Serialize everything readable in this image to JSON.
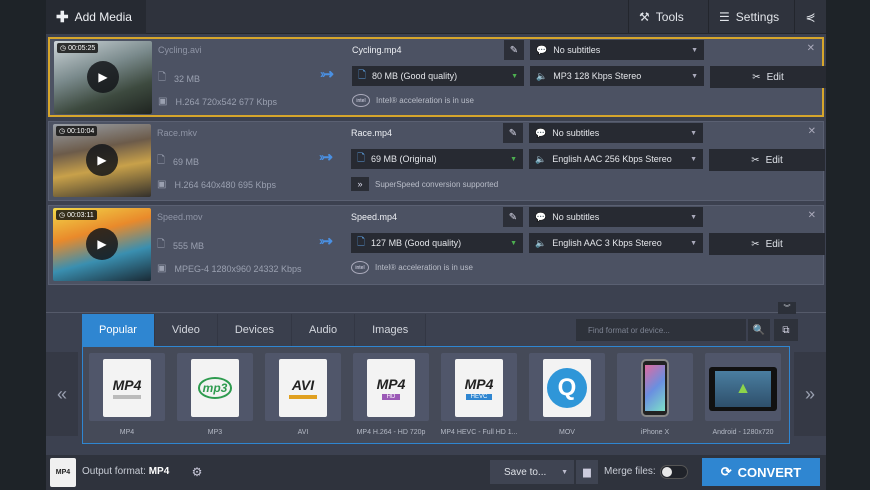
{
  "toolbar": {
    "add_media": "Add Media",
    "tools": "Tools",
    "settings": "Settings"
  },
  "files": [
    {
      "duration": "00:05:25",
      "source_name": "Cycling.avi",
      "source_size": "32 MB",
      "source_codec": "H.264 720x542 677 Kbps",
      "output_name": "Cycling.mp4",
      "output_size": "80 MB (Good quality)",
      "subtitles": "No subtitles",
      "audio": "MP3 128 Kbps Stereo",
      "accel": "Intel® acceleration is in use",
      "edit": "Edit",
      "selected": true
    },
    {
      "duration": "00:10:04",
      "source_name": "Race.mkv",
      "source_size": "69 MB",
      "source_codec": "H.264 640x480 695 Kbps",
      "output_name": "Race.mp4",
      "output_size": "69 MB (Original)",
      "subtitles": "No subtitles",
      "audio": "English AAC 256 Kbps Stereo",
      "accel": "SuperSpeed conversion supported",
      "edit": "Edit",
      "selected": false
    },
    {
      "duration": "00:03:11",
      "source_name": "Speed.mov",
      "source_size": "555 MB",
      "source_codec": "MPEG-4 1280x960 24332 Kbps",
      "output_name": "Speed.mp4",
      "output_size": "127 MB (Good quality)",
      "subtitles": "No subtitles",
      "audio": "English AAC 3 Kbps Stereo",
      "accel": "Intel® acceleration is in use",
      "edit": "Edit",
      "selected": false
    }
  ],
  "tabs": [
    "Popular",
    "Video",
    "Devices",
    "Audio",
    "Images"
  ],
  "search": {
    "placeholder": "Find format or device..."
  },
  "formats": [
    {
      "label": "MP4",
      "icon": "MP4",
      "sub": ""
    },
    {
      "label": "MP3",
      "icon": "mp3",
      "sub": ""
    },
    {
      "label": "AVI",
      "icon": "AVI",
      "sub": ""
    },
    {
      "label": "MP4 H.264 - HD 720p",
      "icon": "MP4",
      "sub": "HD"
    },
    {
      "label": "MP4 HEVC - Full HD 1...",
      "icon": "MP4",
      "sub": "HEVC"
    },
    {
      "label": "MOV",
      "icon": "Q",
      "sub": ""
    },
    {
      "label": "iPhone X",
      "icon": "",
      "sub": ""
    },
    {
      "label": "Android - 1280x720",
      "icon": "",
      "sub": ""
    }
  ],
  "footer": {
    "output_format_label": "Output format:",
    "output_format_value": "MP4",
    "save_to": "Save to...",
    "merge_files": "Merge files:",
    "convert": "CONVERT"
  },
  "colors": {
    "accent": "#2f86d1",
    "selection": "#d6a62c"
  }
}
